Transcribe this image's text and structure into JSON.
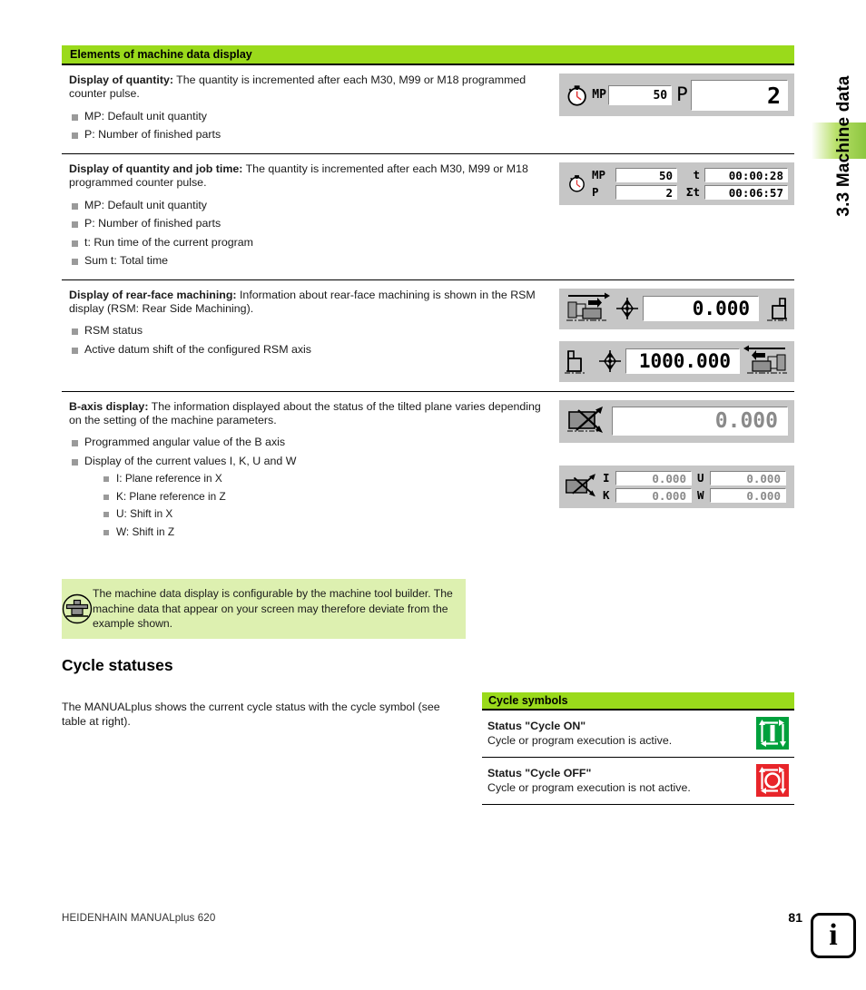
{
  "chapter_tab": {
    "label": "3.3 Machine data"
  },
  "table": {
    "header": "Elements of machine data display",
    "rows": [
      {
        "lead_bold": "Display of quantity:",
        "lead_rest": " The quantity is incremented after each M30, M99 or M18 programmed counter pulse.",
        "bullets": [
          "MP: Default unit quantity",
          "P: Number of finished parts"
        ]
      },
      {
        "lead_bold": "Display of quantity and job time:",
        "lead_rest": " The quantity is incremented after each M30, M99 or M18 programmed counter pulse.",
        "bullets": [
          "MP: Default unit quantity",
          "P: Number of finished parts",
          "t: Run time of the current program",
          "Sum t: Total time"
        ]
      },
      {
        "lead_bold": "Display of rear-face machining:",
        "lead_rest": " Information about rear-face machining is shown in the RSM display (RSM: Rear Side Machining).",
        "bullets": [
          "RSM status",
          "Active datum shift of the configured RSM axis"
        ]
      },
      {
        "lead_bold": "B-axis display:",
        "lead_rest": " The information displayed about the status of the tilted plane varies depending on the setting of the machine parameters.",
        "bullets": [
          "Programmed angular value of the B axis",
          "Display of the current values I, K, U and W"
        ],
        "sub_bullets": [
          "I: Plane reference in X",
          "K: Plane reference in Z",
          "U: Shift in X",
          "W: Shift in Z"
        ]
      }
    ]
  },
  "widgets": {
    "quantity": {
      "mp_label": "MP",
      "mp_value": "50",
      "p_label": "P",
      "p_value": "2"
    },
    "quantity_time": {
      "mp_label": "MP",
      "mp_value": "50",
      "t_label": "t",
      "t_value": "00:00:28",
      "p_label": "P",
      "p_value": "2",
      "sumt_label": "Σt",
      "sumt_value": "00:06:57"
    },
    "rsm_1": {
      "value": "0.000"
    },
    "rsm_2": {
      "value": "1000.000"
    },
    "baxis_angle": {
      "value": "0.000"
    },
    "baxis_values": {
      "i_label": "I",
      "i_value": "0.000",
      "u_label": "U",
      "u_value": "0.000",
      "k_label": "K",
      "k_value": "0.000",
      "w_label": "W",
      "w_value": "0.000"
    }
  },
  "note": {
    "icon": "machine-tool-builder-icon",
    "text": "The machine data display is configurable by the machine tool builder. The machine data that appear on your screen may therefore deviate from the example shown."
  },
  "cycle_section": {
    "heading": "Cycle statuses",
    "paragraph": "The MANUALplus shows the current cycle status with the cycle symbol (see table at right).",
    "table_header": "Cycle symbols",
    "rows": [
      {
        "title": "Status \"Cycle ON\"",
        "desc": "Cycle or program execution is active.",
        "icon": "cycle-on-icon",
        "color": "#00a03c"
      },
      {
        "title": "Status \"Cycle OFF\"",
        "desc": "Cycle or program execution is not active.",
        "icon": "cycle-off-icon",
        "color": "#e8252a"
      }
    ]
  },
  "footer": {
    "product": "HEIDENHAIN MANUALplus 620",
    "page_number": "81",
    "info_icon_letter": "i"
  },
  "colors": {
    "header_green": "#9ada1b",
    "note_green": "#ddf0b0",
    "tab_green": "#8cc63f",
    "display_gray": "#c6c6c6"
  }
}
